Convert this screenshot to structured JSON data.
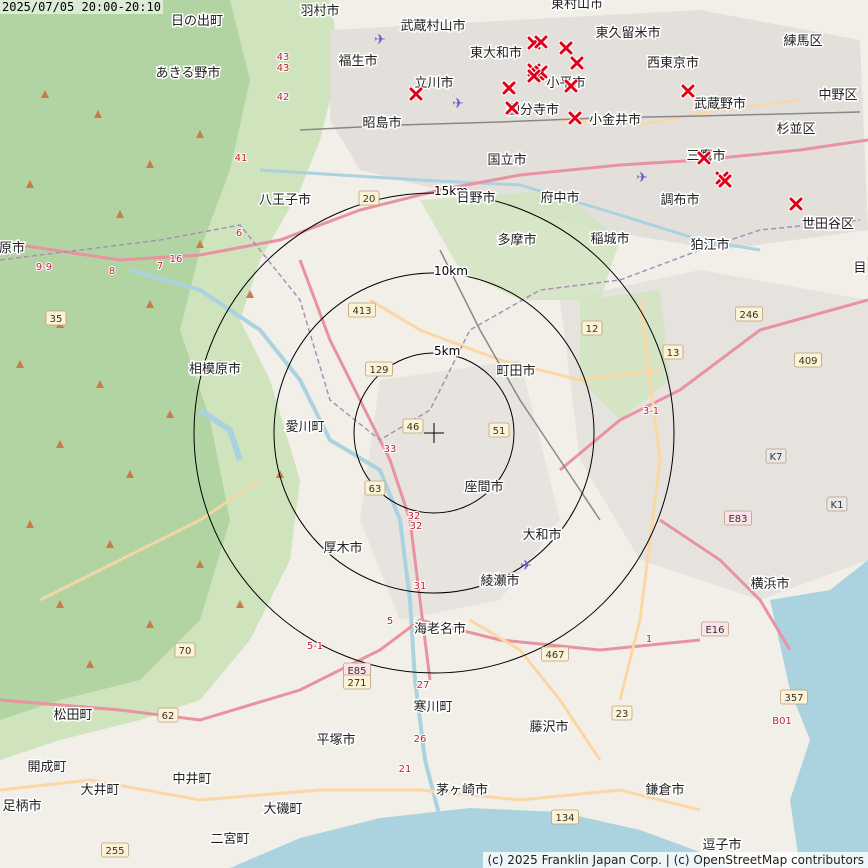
{
  "timestamp": "2025/07/05 20:00-20:10",
  "attribution": "(c) 2025 Franklin Japan Corp. | (c) OpenStreetMap contributors",
  "colors": {
    "sea": "#aad3df",
    "forest": "#add19e",
    "urban": "#e0dfdf",
    "motorway": "#e892a2",
    "primary": "#fcd6a4",
    "marker": "#e0001a"
  },
  "rings": [
    "5km",
    "10km",
    "15km"
  ],
  "cities": [
    "羽村市",
    "武蔵村山市",
    "東村山市",
    "東久留米市",
    "日の出町",
    "東大和市",
    "福生市",
    "西東京市",
    "練馬区",
    "あきる野市",
    "立川市",
    "小平市",
    "武蔵野市",
    "中野区",
    "国分寺市",
    "昭島市",
    "小金井市",
    "杉並区",
    "国立市",
    "三鷹市",
    "八王子市",
    "日野市",
    "府中市",
    "調布市",
    "世田谷区",
    "多摩市",
    "稲城市",
    "狛江市",
    "原市",
    "目",
    "町田市",
    "相模原市",
    "愛川町",
    "座間市",
    "厚木市",
    "大和市",
    "綾瀬市",
    "横浜市",
    "海老名市",
    "寒川町",
    "松田町",
    "平塚市",
    "藤沢市",
    "開成町",
    "大井町",
    "中井町",
    "足柄市",
    "大磯町",
    "茅ヶ崎市",
    "鎌倉市",
    "二宮町",
    "逗子市"
  ],
  "routes": [
    "43",
    "43",
    "42",
    "41",
    "20",
    "16",
    "35",
    "413",
    "129",
    "46",
    "51",
    "33",
    "63",
    "32",
    "32",
    "12",
    "13",
    "246",
    "409",
    "K7",
    "E83",
    "K1",
    "467",
    "1",
    "E16",
    "70",
    "E85",
    "271",
    "62",
    "23",
    "357",
    "B01",
    "255",
    "134",
    "27",
    "26",
    "21",
    "5",
    "7",
    "9-9",
    "8",
    "6",
    "31",
    "3-1",
    "5-1"
  ],
  "strike_count": 18
}
